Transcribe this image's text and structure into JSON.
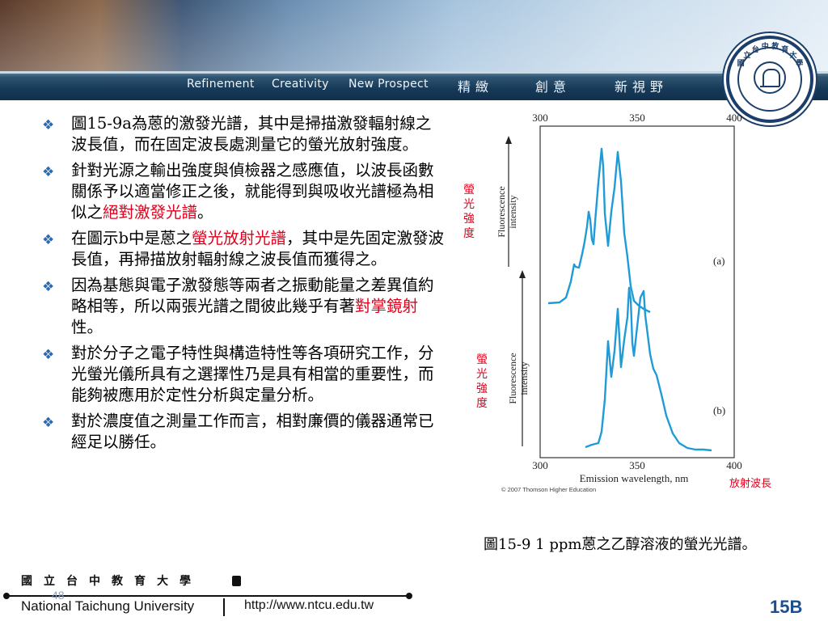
{
  "header": {
    "slogan_en": [
      "Refinement",
      "Creativity",
      "New Prospect"
    ],
    "slogan_cn": [
      "精緻",
      "創意",
      "新視野"
    ]
  },
  "bullets": [
    {
      "parts": [
        {
          "text": "圖15-9a為蒽的激發光譜，其中是掃描激發輻射線之波長值，而在固定波長處測量它的螢光放射強度。",
          "red": false
        }
      ]
    },
    {
      "parts": [
        {
          "text": "針對光源之輸出強度與偵檢器之感應值，以波長函數關係予以適當修正之後，就能得到與吸收光譜極為相似之",
          "red": false
        },
        {
          "text": "絕對激發光譜",
          "red": true
        },
        {
          "text": "。",
          "red": false
        }
      ]
    },
    {
      "parts": [
        {
          "text": "在圖示b中是蒽之",
          "red": false
        },
        {
          "text": "螢光放射光譜",
          "red": true
        },
        {
          "text": "，其中是先固定激發波長值，再掃描放射輻射線之波長值而獲得之。",
          "red": false
        }
      ]
    },
    {
      "parts": [
        {
          "text": "因為基態與電子激發態等兩者之振動能量之差異值約略相等，所以兩張光譜之間彼此幾乎有著",
          "red": false
        },
        {
          "text": "對掌鏡射",
          "red": true
        },
        {
          "text": "性。",
          "red": false
        }
      ]
    },
    {
      "parts": [
        {
          "text": "對於分子之電子特性與構造特性等各項研究工作，分光螢光儀所具有之選擇性乃是具有相當的重要性，而能夠被應用於定性分析與定量分析。",
          "red": false
        }
      ]
    },
    {
      "parts": [
        {
          "text": "對於濃度值之測量工作而言，相對廉價的儀器通常已經足以勝任。",
          "red": false
        }
      ]
    }
  ],
  "figure": {
    "top_ticks": [
      "300",
      "350",
      "400"
    ],
    "bottom_ticks": [
      "300",
      "350",
      "400"
    ],
    "xlabel": "Emission wavelength, nm",
    "xlabel_cn": "放射波長",
    "ylabel_en_line1": "Fluorescence",
    "ylabel_en_line2": "intensity",
    "ylabel_cn": "螢光強度",
    "panel_a_label": "(a)",
    "panel_b_label": "(b)",
    "copyright": "© 2007 Thomson Higher Education",
    "line_color": "#1f9bd7"
  },
  "caption": "圖15-9 1 ppm蒽之乙醇溶液的螢光光譜。",
  "footer": {
    "university_cn": "國立台中教育大學",
    "university_en": "National Taichung University",
    "url": "http://www.ntcu.edu.tw",
    "page_number": "48",
    "slide_code": "15B"
  },
  "logo": {
    "rim_text": "國立台中教育大學"
  }
}
